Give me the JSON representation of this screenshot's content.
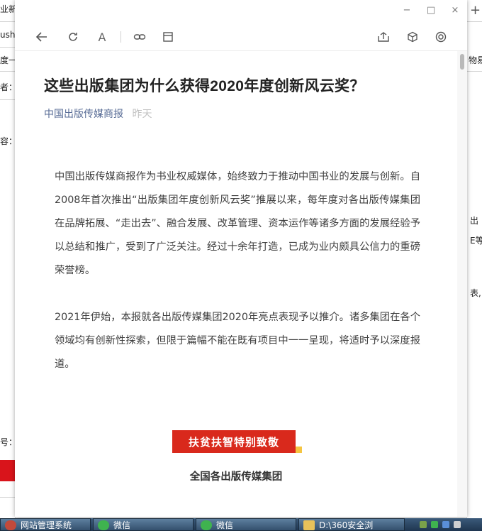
{
  "background_app": {
    "left_texts": [
      "业新",
      "ush",
      "度一",
      "者：",
      "容：",
      "号："
    ],
    "right_texts": [
      "+",
      "物易",
      "出",
      "E等",
      "表,"
    ]
  },
  "window_controls": {
    "minimize": "−",
    "maximize": "□",
    "close": "×"
  },
  "toolbar": {
    "font_label": "A"
  },
  "article": {
    "title": "这些出版集团为什么获得2020年度创新风云奖？",
    "source": "中国出版传媒商报",
    "date": "昨天",
    "paragraphs": [
      "中国出版传媒商报作为书业权威媒体，始终致力于推动中国书业的发展与创新。自2008年首次推出“出版集团年度创新风云奖”推展以来，每年度对各出版传媒集团在品牌拓展、“走出去”、融合发展、改革管理、资本运作等诸多方面的发展经验予以总结和推广，受到了广泛关注。经过十余年打造，已成为业内颇具公信力的重磅荣誉榜。",
      "2021年伊始，本报就各出版传媒集团2020年亮点表现予以推介。诸多集团在各个领域均有创新性探索，但限于篇幅不能在既有项目中一一呈现，将适时予以深度报道。"
    ],
    "banner": "扶贫扶智特别致敬",
    "subtitle": "全国各出版传媒集团"
  },
  "taskbar": {
    "items": [
      {
        "label": "网站管理系统",
        "icon_color": "#c24a3b"
      },
      {
        "label": "微信",
        "icon_color": "#3fb34f"
      },
      {
        "label": "微信",
        "icon_color": "#3fb34f"
      },
      {
        "label": "D:\\360安全浏",
        "icon_color": "#e7c25a"
      }
    ]
  },
  "colors": {
    "accent_red": "#d9291c",
    "source_link": "#576b95",
    "date_gray": "#c2c2c2"
  }
}
